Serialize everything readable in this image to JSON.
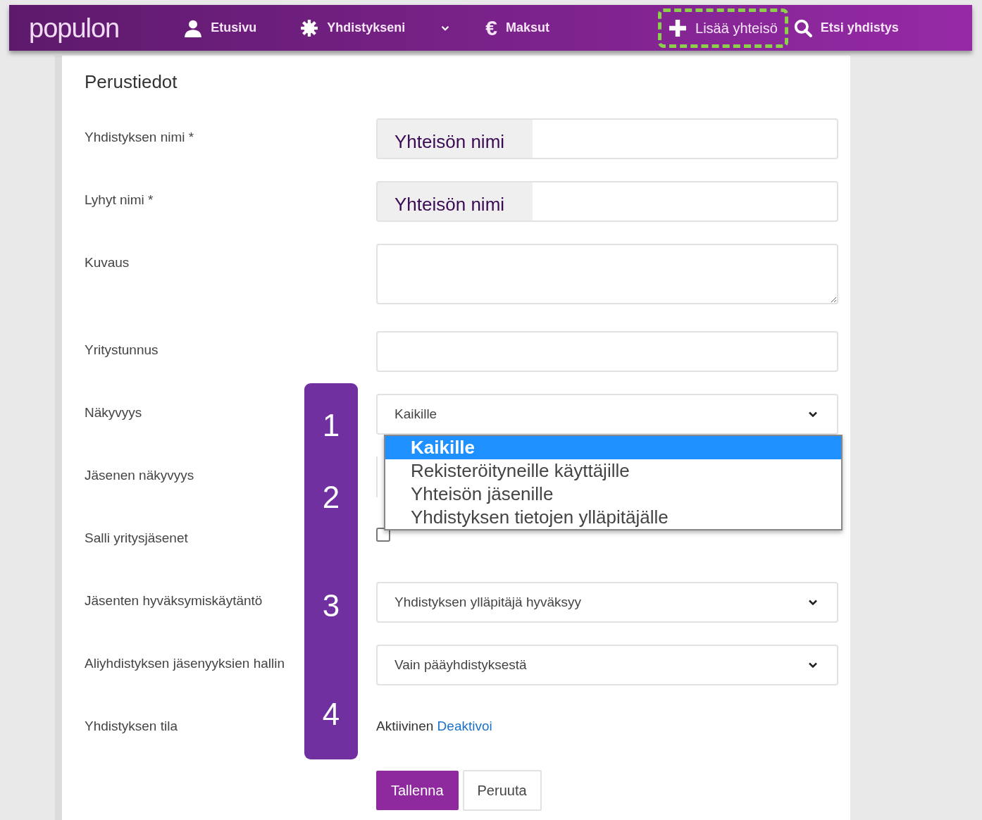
{
  "navbar": {
    "logo": "populon",
    "items": [
      {
        "kind": "link",
        "label": "Etusivu",
        "highlighted": false
      },
      {
        "kind": "link",
        "label": "Yhdistykseni",
        "highlighted": false
      },
      {
        "kind": "caret"
      },
      {
        "kind": "link",
        "glyph": "€",
        "label": "Maksut",
        "highlighted": false
      },
      {
        "kind": "link",
        "label": "Lisää yhteisö",
        "highlighted": true
      },
      {
        "kind": "link",
        "label": "Etsi yhdistys",
        "highlighted": false
      }
    ]
  },
  "form": {
    "title": "Perustiedot",
    "rows": [
      {
        "kind": "text",
        "label": "Yhdistyksen nimi *",
        "value": "Yhteisön nimi"
      },
      {
        "kind": "text",
        "label": "Lyhyt nimi *",
        "value": "Yhteisön nimi"
      },
      {
        "kind": "textarea",
        "label": "Kuvaus"
      },
      {
        "kind": "text",
        "label": "Yritystunnus"
      },
      {
        "kind": "select",
        "label": "Näkyvyys",
        "value": "Kaikille",
        "expanded": true,
        "options": [
          {
            "label": "Kaikille",
            "selected": true
          },
          {
            "label": "Rekisteröityneille käyttäjille",
            "selected": false
          },
          {
            "label": "Yhteisön jäsenille",
            "selected": false
          },
          {
            "label": "Yhdistyksen tietojen ylläpitäjälle",
            "selected": false
          }
        ]
      },
      {
        "kind": "hidden",
        "label": "Jäsenen näkyvyys"
      },
      {
        "kind": "checkbox",
        "label": "Salli yritysjäsenet",
        "checked": false
      },
      {
        "kind": "select",
        "label": "Jäsenten hyväksymiskäytäntö",
        "value": "Yhdistyksen ylläpitäjä hyväksyy",
        "expanded": false
      },
      {
        "kind": "select",
        "label": "Aliyhdistyksen jäsenyyksien hallin",
        "value": "Vain pääyhdistyksestä",
        "expanded": false
      },
      {
        "kind": "status",
        "label": "Yhdistyksen tila",
        "value": "Aktiivinen",
        "link": "Deaktivoi"
      }
    ],
    "buttons": [
      {
        "label": "Tallenna",
        "kind": "primary"
      },
      {
        "label": "Peruuta",
        "kind": "secondary"
      }
    ]
  },
  "annotation": {
    "steps": [
      "1",
      "2",
      "3",
      "4"
    ]
  }
}
